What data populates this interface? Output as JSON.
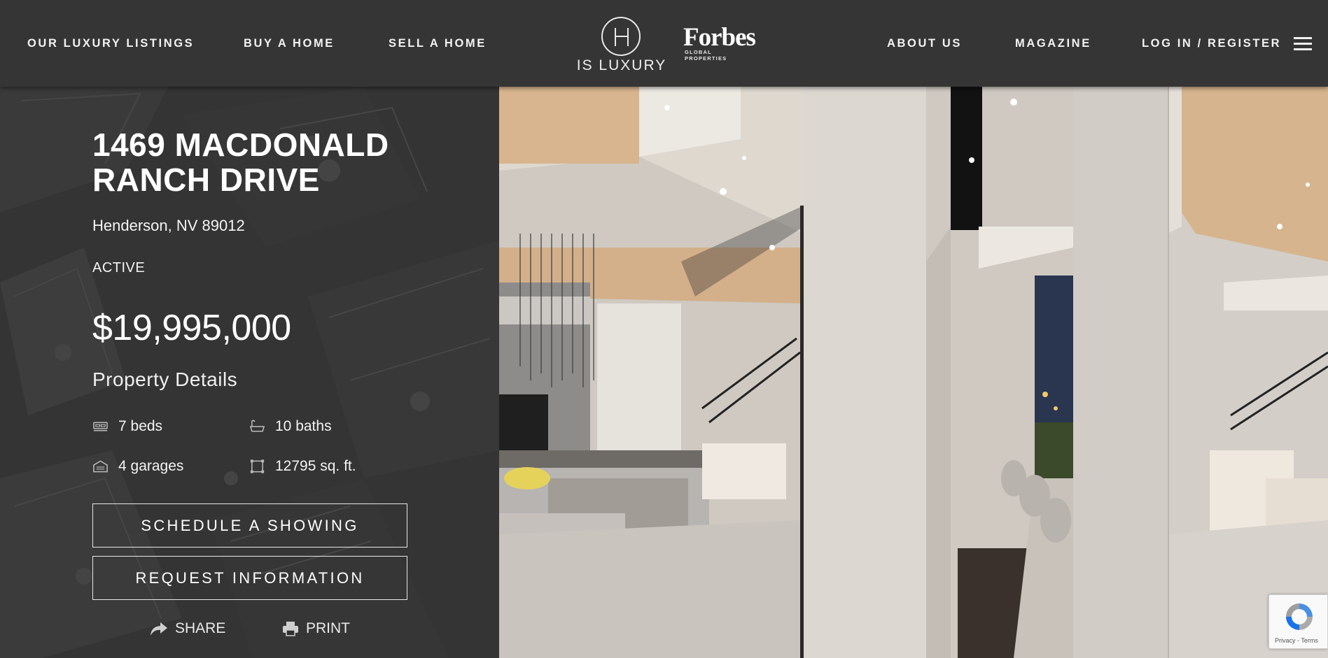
{
  "nav": {
    "left": [
      "OUR LUXURY LISTINGS",
      "BUY A HOME",
      "SELL A HOME"
    ],
    "right": [
      "ABOUT US",
      "MAGAZINE",
      "LOG IN / REGISTER"
    ]
  },
  "brand": {
    "logo_text": "IS LUXURY",
    "partner_name": "Forbes",
    "partner_sub": "GLOBAL PROPERTIES"
  },
  "listing": {
    "address_line1": "1469 MACDONALD",
    "address_line2": "RANCH DRIVE",
    "city": "Henderson, NV 89012",
    "status": "ACTIVE",
    "price": "$19,995,000",
    "details_title": "Property Details",
    "beds": "7 beds",
    "baths": "10 baths",
    "garages": "4 garages",
    "area": "12795 sq. ft."
  },
  "actions": {
    "schedule": "SCHEDULE A SHOWING",
    "request": "REQUEST INFORMATION",
    "share": "SHARE",
    "print": "PRINT"
  },
  "recaptcha": {
    "terms": "Privacy - Terms"
  },
  "icons": [
    "bed-icon",
    "bath-icon",
    "garage-icon",
    "area-icon",
    "share-icon",
    "print-icon",
    "hamburger-menu-icon",
    "recaptcha-icon"
  ]
}
